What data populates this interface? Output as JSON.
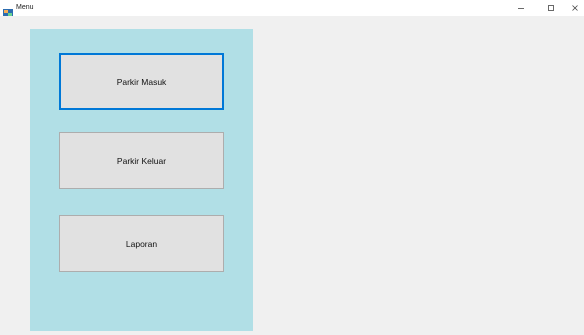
{
  "window": {
    "title": "Menu",
    "controls": {
      "minimize": "minimize-icon",
      "maximize": "maximize-icon",
      "close": "close-icon"
    }
  },
  "menu": {
    "buttons": [
      {
        "label": "Parkir Masuk",
        "focused": true
      },
      {
        "label": "Parkir Keluar",
        "focused": false
      },
      {
        "label": "Laporan",
        "focused": false
      }
    ]
  },
  "colors": {
    "panel_background": "#b1dfe6",
    "button_background": "#e1e1e1",
    "focus_border": "#0078d7",
    "window_background": "#f0f0f0"
  }
}
